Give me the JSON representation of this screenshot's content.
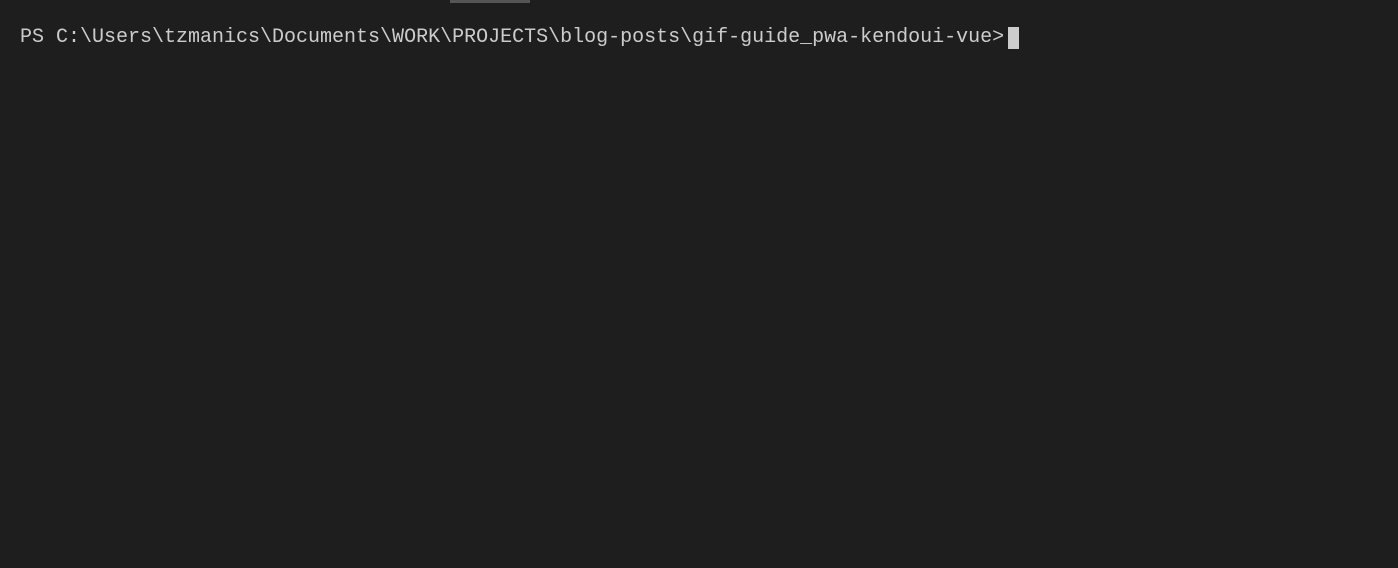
{
  "terminal": {
    "prompt": "PS C:\\Users\\tzmanics\\Documents\\WORK\\PROJECTS\\blog-posts\\gif-guide_pwa-kendoui-vue>",
    "input_value": ""
  }
}
